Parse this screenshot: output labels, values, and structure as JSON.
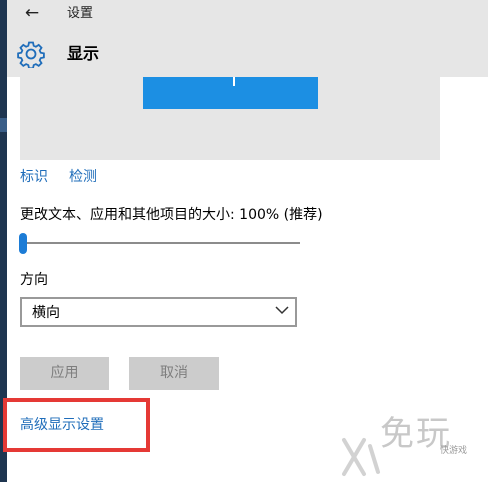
{
  "window": {
    "title": "设置"
  },
  "header": {
    "title": "显示"
  },
  "display": {
    "identify_label": "标识",
    "detect_label": "检测"
  },
  "scale": {
    "label": "更改文本、应用和其他项目的大小: 100% (推荐)",
    "level_percent": 0
  },
  "orientation": {
    "label": "方向",
    "selected": "横向"
  },
  "buttons": {
    "apply_label": "应用",
    "cancel_label": "取消"
  },
  "advanced": {
    "label": "高级显示设置"
  },
  "watermark": {
    "text": "免玩",
    "small_text": "快游戏"
  },
  "colors": {
    "accent": "#1c8fe3",
    "link": "#1f6dba",
    "highlight": "#e53935",
    "chrome": "#e6e6e6"
  },
  "icons": {
    "back": "back-arrow-icon",
    "settings": "gear-icon",
    "dropdown": "chevron-down-icon"
  }
}
